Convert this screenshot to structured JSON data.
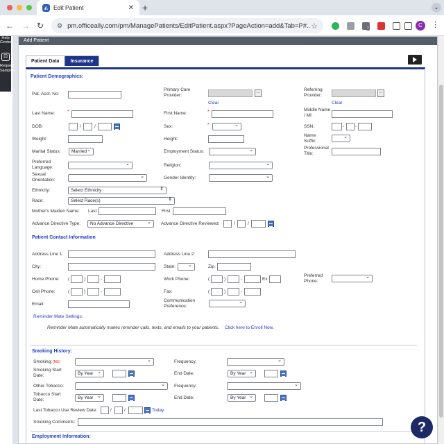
{
  "browser": {
    "tab_title": "Edit Patient",
    "url": "pm.officeally.com/pm/ManagePatients/EditPatient.aspx?PageAction=add&Tab=P#...",
    "avatar_letter": "C",
    "ext_badge": "2"
  },
  "sidebar": {
    "help_center": "Help Center",
    "request_samples": "Request Samples"
  },
  "page": {
    "header": "Add Patient",
    "tabs": [
      "Patient Data",
      "Insurance"
    ],
    "demographics": {
      "title": "Patient Demographics:",
      "pat_acct": "Pat. Acct. No:",
      "pcp": "Primary Care Provider:",
      "referring": "Referring Provider:",
      "clear": "Clear",
      "last_name": "Last Name:",
      "first_name": "First Name:",
      "middle_name": "Middle Name / MI:",
      "dob": "DOB:",
      "sex": "Sex:",
      "ssn": "SSN:",
      "weight": "Weight:",
      "height": "Height:",
      "name_suffix": "Name Suffix:",
      "marital": "Marital Status:",
      "marital_value": "Married",
      "employment": "Employment Status:",
      "prof_title": "Professional Title:",
      "language": "Preferred Language:",
      "religion": "Religion:",
      "sexual": "Sexual Orientation:",
      "gender": "Gender Identity:",
      "ethnicity": "Ethnicity:",
      "ethnicity_value": "Select Ethnicity",
      "race": "Race:",
      "race_value": "Select Race(s)",
      "maiden": "Mother's Maiden Name:",
      "maiden_last": "Last",
      "maiden_first": "First",
      "adv_dir": "Advance Directive Type:",
      "adv_dir_value": "No Advance Directive",
      "adv_reviewed": "Advance Directive Reviewed:",
      "slash": "/",
      "dash": "-",
      "asterisk": "*"
    },
    "contact": {
      "title": "Patient Contact Information",
      "addr1": "Address Line 1:",
      "addr2": "Address Line 2:",
      "city": "City:",
      "state": "State:",
      "zip": "Zip:",
      "home_phone": "Home Phone:",
      "work_phone": "Work Phone:",
      "ex": "Ex",
      "pref_phone": "Preferred Phone:",
      "cell_phone": "Cell Phone:",
      "fax": "Fax:",
      "email": "Email:",
      "comm_pref": "Communication Preference:",
      "reminder_settings": "Reminder Mate Settings:",
      "reminder_text": "Reminder Mate automatically makes reminder calls, texts, and emails to your patients.",
      "enroll": "Click here to Enroll Now.",
      "paren_open": "(",
      "paren_close": ")"
    },
    "smoking": {
      "title": "Smoking History:",
      "smoking": "Smoking:",
      "mu": "(MU)",
      "frequency": "Frequency:",
      "start_date": "Smoking Start Date:",
      "by_year": "By Year",
      "end_date": "End Date:",
      "other_tobacco": "Other Tobacco:",
      "tobacco_start": "Tobacco Start Date:",
      "last_review": "Last Tobacco Use Review Date:",
      "today": "Today",
      "comments": "Smoking Comments:"
    },
    "employment": {
      "title": "Employment Information:"
    }
  },
  "help_button": "?",
  "colors": {
    "brand": "#1b3488",
    "link": "#1f3ec8",
    "required": "#e02020"
  }
}
